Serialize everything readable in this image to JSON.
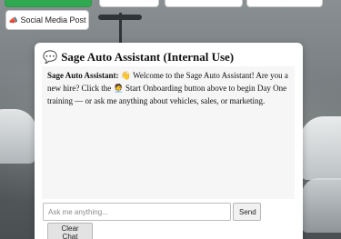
{
  "top_buttons": {
    "social_media_label": "Social Media Post",
    "social_media_icon": "megaphone-icon",
    "social_media_glyph": "📣"
  },
  "panel": {
    "title": "Sage Auto Assistant (Internal Use)",
    "title_icon": "speech-bubble-icon",
    "title_glyph": "💬"
  },
  "chat": {
    "messages": [
      {
        "speaker": "Sage Auto Assistant:",
        "wave_glyph": "👋",
        "text_before": " Welcome to the Sage Auto Assistant! Are you a new hire? Click the ",
        "person_glyph": "🧑‍💼",
        "text_after": " Start Onboarding button above to begin Day One training — or ask me anything about vehicles, sales, or marketing."
      }
    ]
  },
  "input": {
    "placeholder": "Ask me anything...",
    "value": ""
  },
  "buttons": {
    "send_label": "Send",
    "clear_label": "Clear Chat"
  },
  "colors": {
    "accent_green": "#2fa84f",
    "panel_bg": "#ffffff",
    "chat_bg": "#f6f6f6"
  }
}
